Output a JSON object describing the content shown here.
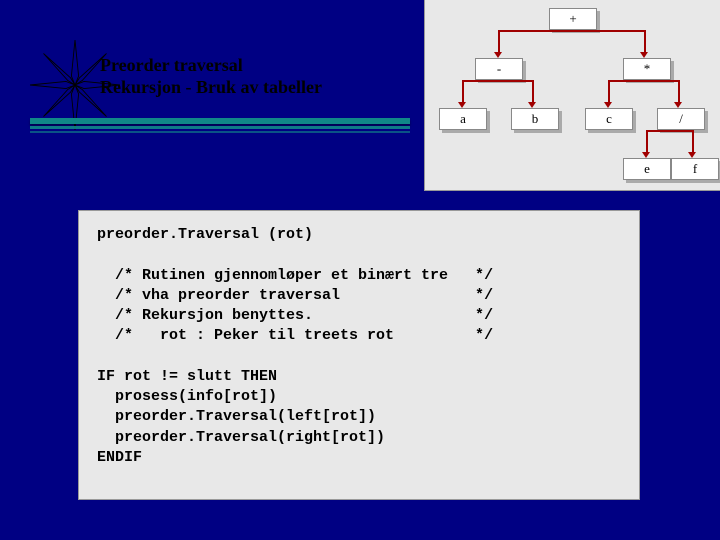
{
  "title": {
    "line1": "Preorder traversal",
    "line2": "Rekursjon   -   Bruk av tabeller"
  },
  "tree": {
    "root": "+",
    "l": "-",
    "r": "*",
    "ll": "a",
    "lr": "b",
    "rl": "c",
    "rr": "/",
    "rrl": "e",
    "rrr": "f"
  },
  "code": {
    "l1": "preorder.Traversal (rot)",
    "l2": "",
    "l3": "  /* Rutinen gjennomløper et binært tre   */",
    "l4": "  /* vha preorder traversal               */",
    "l5": "  /* Rekursjon benyttes.                  */",
    "l6": "  /*   rot : Peker til treets rot         */",
    "l7": "",
    "l8": "IF rot != slutt THEN",
    "l9": "  prosess(info[rot])",
    "l10": "  preorder.Traversal(left[rot])",
    "l11": "  preorder.Traversal(right[rot])",
    "l12": "ENDIF"
  }
}
